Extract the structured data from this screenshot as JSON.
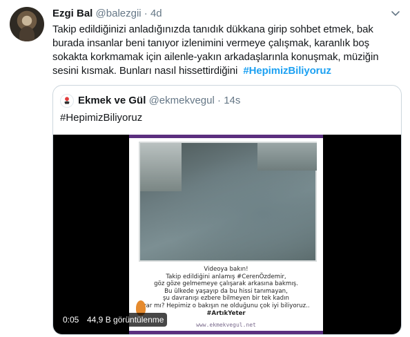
{
  "tweet": {
    "name": "Ezgi Bal",
    "handle": "@balezgii",
    "separator": "·",
    "time": "4d",
    "text_lines": [
      "Takip edildiğinizi anladığınızda tanıdık dükkana girip sohbet etmek, bak",
      "burada insanlar beni tanıyor izlenimini vermeye çalışmak, karanlık boş",
      "sokakta korkmamak için ailenle-yakın arkadaşlarınla konuşmak, müziğin",
      "sesini kısmak. Bunları nasıl hissettirdiğini "
    ],
    "hashtag": "#HepimizBiliyoruz",
    "more_icon": "chevron-down-icon"
  },
  "quote": {
    "name": "Ekmek ve Gül",
    "handle": "@ekmekvegul",
    "separator": "·",
    "time": "14s",
    "text": "#HepimizBiliyoruz",
    "avatar_icon": "rose-logo-icon"
  },
  "video": {
    "caption_lines": [
      "Videoya bakın!",
      "Takip edildiğini anlamış #CerenÖzdemir,",
      "göz göze gelmemeye çalışarak arkasına bakmış.",
      "Bu ülkede yaşayıp da bu hissi tanımayan,",
      "şu davranışı ezbere bilmeyen bir tek kadın",
      "var mı? Hepimiz o bakışın ne olduğunu çok iyi biliyoruz.."
    ],
    "caption_hashtag": "#ArtıkYeter",
    "site": "www.ekmekvegul.net",
    "duration": "0:05",
    "views": "44,9 B görüntülenme"
  },
  "colors": {
    "link": "#1da1f2",
    "muted": "#657786",
    "frame_accent": "#5b2f7e",
    "border": "#ccd6dd"
  }
}
